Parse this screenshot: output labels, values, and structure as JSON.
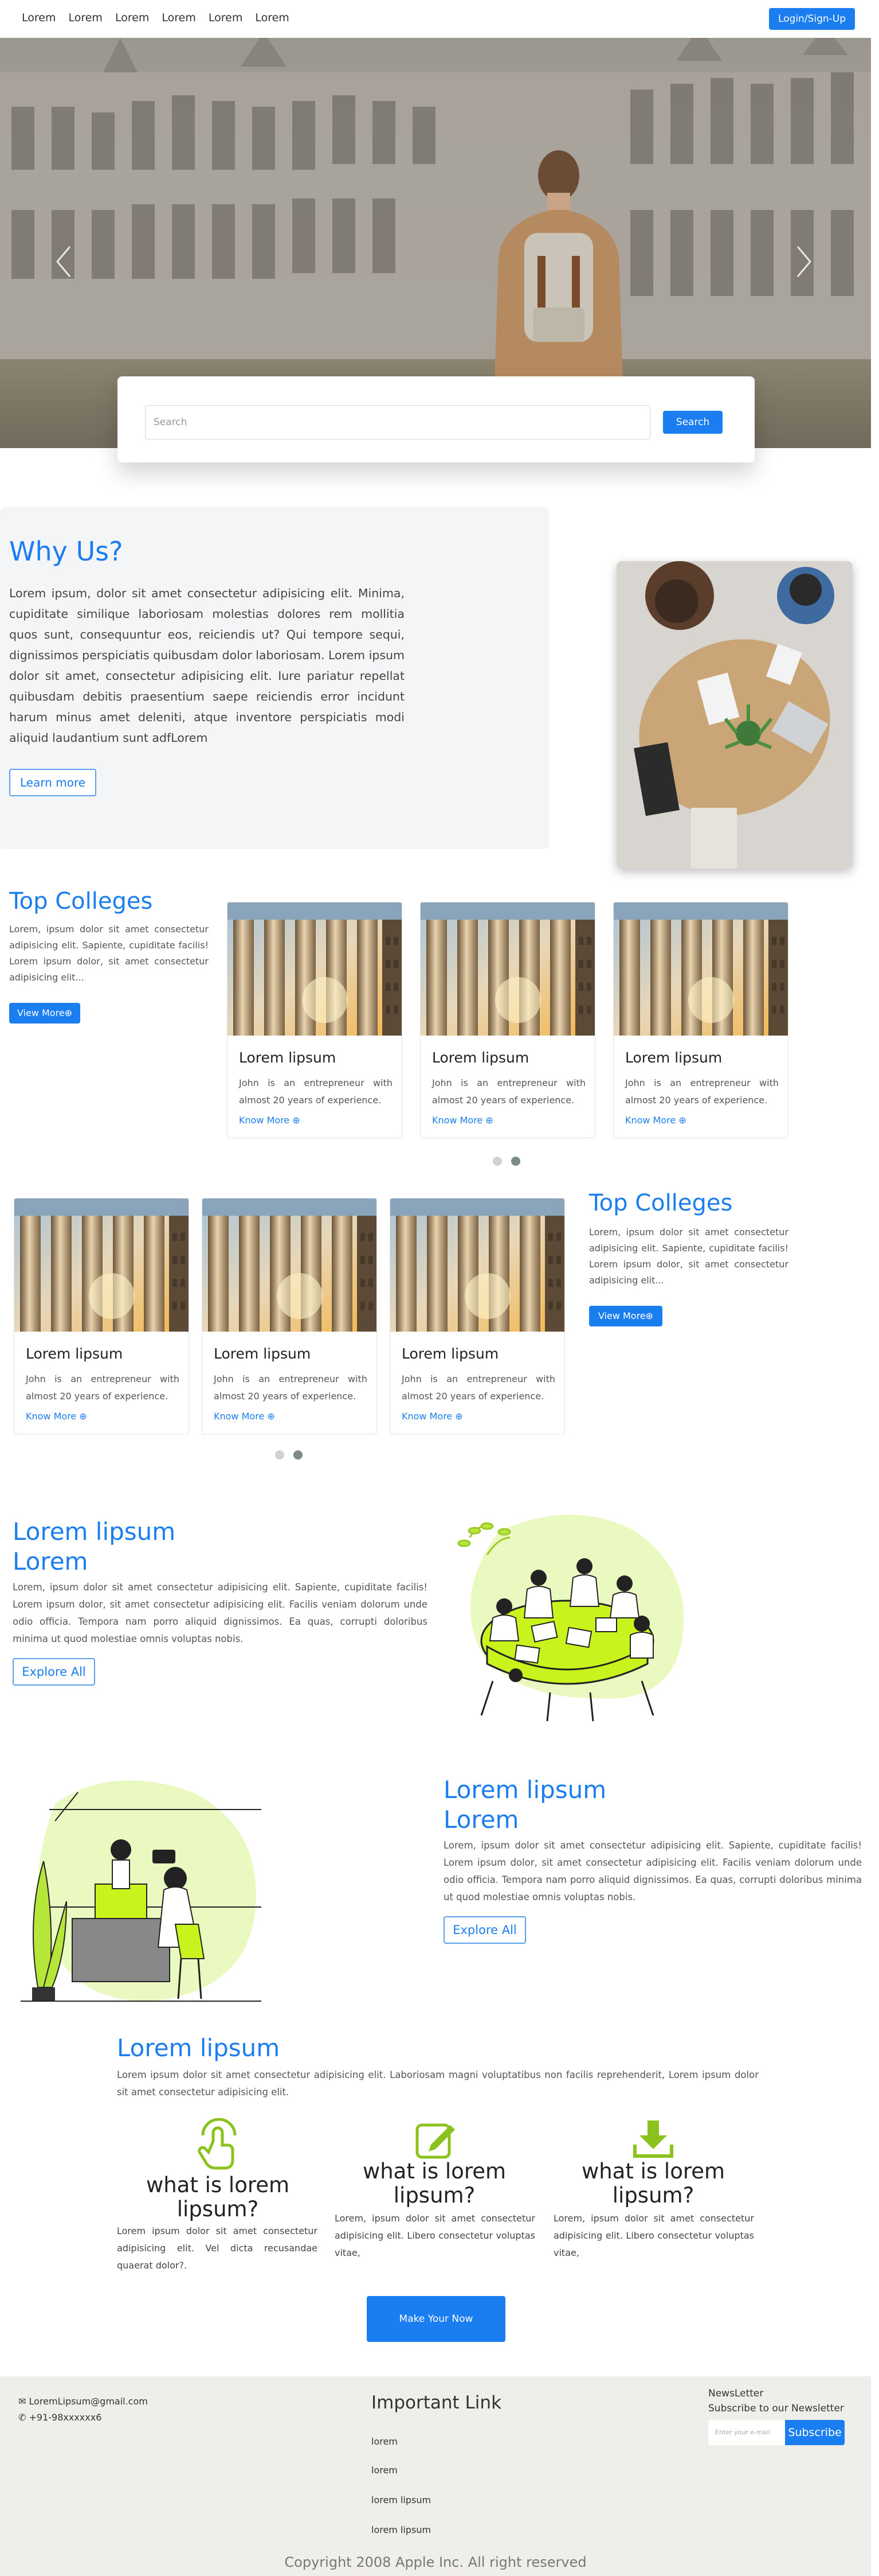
{
  "nav": {
    "links": [
      "Lorem",
      "Lorem",
      "Lorem",
      "Lorem",
      "Lorem",
      "Lorem"
    ],
    "login_label": "Login/Sign-Up"
  },
  "search": {
    "placeholder": "Search",
    "button_label": "Search"
  },
  "why": {
    "title": "Why Us?",
    "text": "Lorem ipsum, dolor sit amet consectetur adipisicing elit. Minima, cupiditate similique laboriosam molestias dolores rem mollitia quos sunt, consequuntur eos, reiciendis ut? Qui tempore sequi, dignissimos perspiciatis quibusdam dolor laboriosam. Lorem ipsum dolor sit amet, consectetur adipisicing elit. Iure pariatur repellat quibusdam debitis praesentium saepe reiciendis error incidunt harum minus amet deleniti, atque inventore perspiciatis modi aliquid laudantium sunt adfLorem",
    "button_label": "Learn more"
  },
  "colleges1": {
    "title": "Top Colleges",
    "text": "Lorem, ipsum dolor sit amet consectetur adipisicing elit. Sapiente, cupiditate facilis! Lorem ipsum dolor, sit amet consectetur adipisicing elit...",
    "button_label": "View More⊕",
    "cards": [
      {
        "title": "Lorem lipsum",
        "text": "John is an entrepreneur with almost 20 years of experience.",
        "link": "Know More ⊕"
      },
      {
        "title": "Lorem lipsum",
        "text": "John is an entrepreneur with almost 20 years of experience.",
        "link": "Know More ⊕"
      },
      {
        "title": "Lorem lipsum",
        "text": "John is an entrepreneur with almost 20 years of experience.",
        "link": "Know More ⊕"
      }
    ]
  },
  "colleges2": {
    "title": "Top Colleges",
    "text": "Lorem, ipsum dolor sit amet consectetur adipisicing elit. Sapiente, cupiditate facilis! Lorem ipsum dolor, sit amet consectetur adipisicing elit...",
    "button_label": "View More⊕",
    "cards": [
      {
        "title": "Lorem lipsum",
        "text": "John is an entrepreneur with almost 20 years of experience.",
        "link": "Know More ⊕"
      },
      {
        "title": "Lorem lipsum",
        "text": "John is an entrepreneur with almost 20 years of experience.",
        "link": "Know More ⊕"
      },
      {
        "title": "Lorem lipsum",
        "text": "John is an entrepreneur with almost 20 years of experience.",
        "link": "Know More ⊕"
      }
    ]
  },
  "section3": {
    "title_line1": "Lorem lipsum",
    "title_line2": "Lorem",
    "text": "Lorem, ipsum dolor sit amet consectetur adipisicing elit. Sapiente, cupiditate facilis! Lorem ipsum dolor, sit amet consectetur adipisicing elit. Facilis veniam dolorum unde odio officia. Tempora nam porro aliquid dignissimos. Ea quas, corrupti doloribus minima ut quod molestiae omnis voluptas nobis.",
    "button_label": "Explore All"
  },
  "section4": {
    "title_line1": "Lorem lipsum",
    "title_line2": "Lorem",
    "text": "Lorem, ipsum dolor sit amet consectetur adipisicing elit. Sapiente, cupiditate facilis! Lorem ipsum dolor, sit amet consectetur adipisicing elit. Facilis veniam dolorum unde odio officia. Tempora nam porro aliquid dignissimos. Ea quas, corrupti doloribus minima ut quod molestiae omnis voluptas nobis.",
    "button_label": "Explore All"
  },
  "features": {
    "title": "Lorem lipsum",
    "text": "Lorem ipsum dolor sit amet consectetur adipisicing elit. Laboriosam magni voluptatibus non facilis reprehenderit, Lorem ipsum dolor sit amet consectetur adipisicing elit.",
    "items": [
      {
        "icon": "hand-pointer-icon",
        "title": "what is lorem lipsum?",
        "text": "Lorem ipsum dolor sit amet consectetur adipisicing elit. Vel dicta recusandae quaerat dolor?."
      },
      {
        "icon": "edit-icon",
        "title": "what is lorem lipsum?",
        "text": "Lorem, ipsum dolor sit amet consectetur adipisicing elit. Libero consectetur voluptas vitae,"
      },
      {
        "icon": "download-icon",
        "title": "what is lorem lipsum?",
        "text": "Lorem, ipsum dolor sit amet consectetur adipisicing elit. Libero consectetur voluptas vitae,"
      }
    ],
    "button_label": "Make Your Now"
  },
  "footer": {
    "email": "LoremLipsum@gmail.com",
    "phone": "+91-98xxxxxx6",
    "links_title": "Important Link",
    "links": [
      "lorem",
      "lorem",
      "lorem lipsum",
      "lorem lipsum"
    ],
    "newsletter_title": "NewsLetter",
    "newsletter_sub": "Subscribe to our Newsletter",
    "email_placeholder": "Enter your e-mail",
    "subscribe_label": "Subscribe",
    "copyright": "Copyright 2008 Apple Inc. All right reserved"
  },
  "colors": {
    "accent": "#1a7df0",
    "illustration": "#c9f31d",
    "footer_bg": "#efeeeb"
  }
}
